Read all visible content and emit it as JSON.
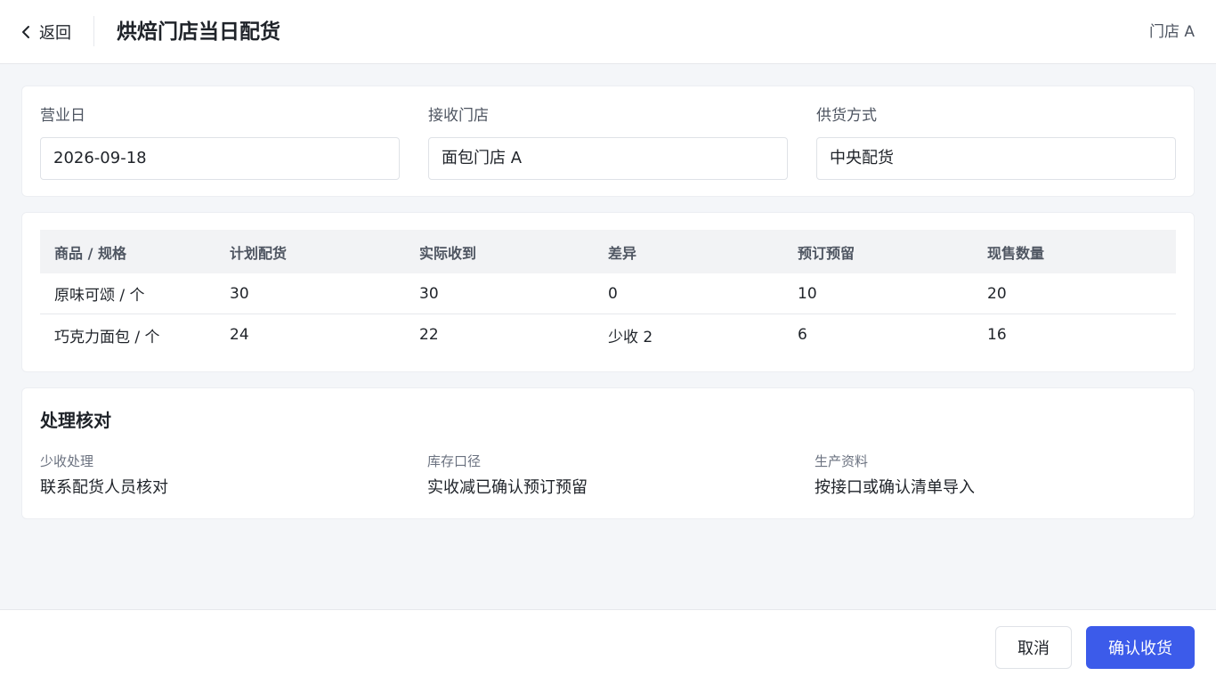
{
  "header": {
    "back_label": "返回",
    "title": "烘焙门店当日配货",
    "store": "门店 A"
  },
  "form": {
    "fields": [
      {
        "label": "营业日",
        "value": "2026-09-18"
      },
      {
        "label": "接收门店",
        "value": "面包门店 A"
      },
      {
        "label": "供货方式",
        "value": "中央配货"
      }
    ]
  },
  "table": {
    "columns": [
      "商品 / 规格",
      "计划配货",
      "实际收到",
      "差异",
      "预订预留",
      "现售数量"
    ],
    "rows": [
      [
        "原味可颂 / 个",
        "30",
        "30",
        "0",
        "10",
        "20"
      ],
      [
        "巧克力面包 / 个",
        "24",
        "22",
        "少收 2",
        "6",
        "16"
      ]
    ]
  },
  "check": {
    "title": "处理核对",
    "items": [
      {
        "label": "少收处理",
        "value": "联系配货人员核对"
      },
      {
        "label": "库存口径",
        "value": "实收减已确认预订预留"
      },
      {
        "label": "生产资料",
        "value": "按接口或确认清单导入"
      }
    ]
  },
  "footer": {
    "cancel_label": "取消",
    "confirm_label": "确认收货"
  },
  "colors": {
    "accent": "#3c5bea",
    "background": "#f4f6f9"
  },
  "icons": {
    "back": "chevron-left-icon"
  }
}
